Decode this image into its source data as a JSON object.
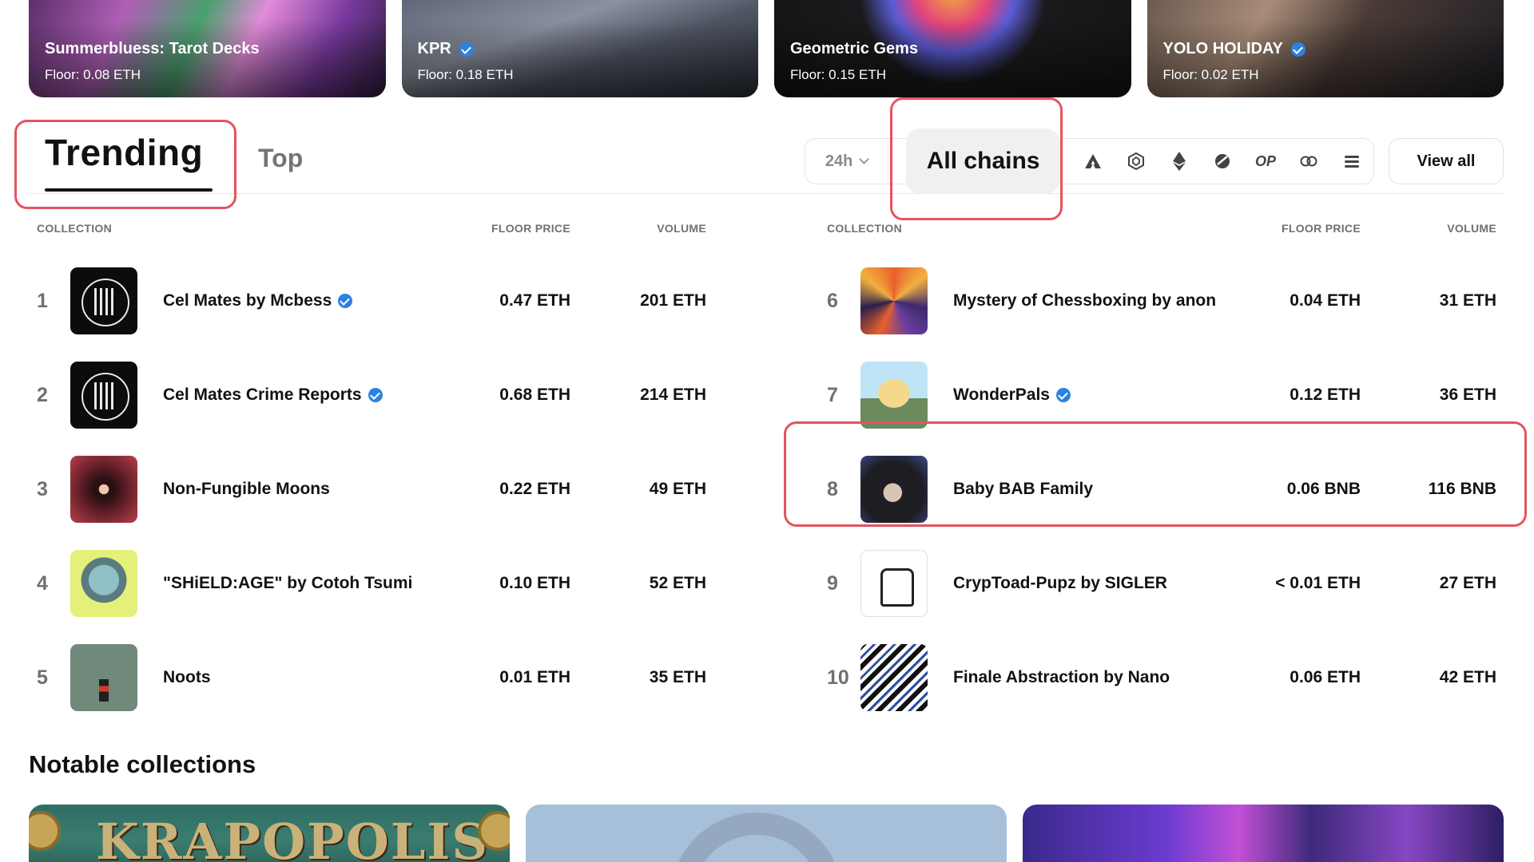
{
  "featured": [
    {
      "title": "Summerbluess: Tarot Decks",
      "floor": "Floor: 0.08 ETH",
      "verified": false
    },
    {
      "title": "KPR",
      "floor": "Floor: 0.18 ETH",
      "verified": true
    },
    {
      "title": "Geometric Gems",
      "floor": "Floor: 0.15 ETH",
      "verified": false
    },
    {
      "title": "YOLO HOLIDAY",
      "floor": "Floor: 0.02 ETH",
      "verified": true
    }
  ],
  "tabs": {
    "trending": "Trending",
    "top": "Top"
  },
  "filters": {
    "period": "24h",
    "all_chains": "All chains",
    "chain_icons": [
      "arbitrum-icon",
      "bnb-icon",
      "ethereum-icon",
      "zora-icon",
      "optimism-icon",
      "link-icon",
      "more-chains-icon"
    ],
    "op_label": "OP"
  },
  "view_all": "View all",
  "columns": {
    "collection": "COLLECTION",
    "floor": "FLOOR PRICE",
    "volume": "VOLUME"
  },
  "left_rows": [
    {
      "rank": "1",
      "name": "Cel Mates by Mcbess",
      "floor": "0.47 ETH",
      "volume": "201 ETH",
      "verified": true
    },
    {
      "rank": "2",
      "name": "Cel Mates Crime Reports",
      "floor": "0.68 ETH",
      "volume": "214 ETH",
      "verified": true
    },
    {
      "rank": "3",
      "name": "Non-Fungible Moons",
      "floor": "0.22 ETH",
      "volume": "49 ETH",
      "verified": false
    },
    {
      "rank": "4",
      "name": "\"SHiELD:AGE\" by Cotoh Tsumi",
      "floor": "0.10 ETH",
      "volume": "52 ETH",
      "verified": false
    },
    {
      "rank": "5",
      "name": "Noots",
      "floor": "0.01 ETH",
      "volume": "35 ETH",
      "verified": false
    }
  ],
  "right_rows": [
    {
      "rank": "6",
      "name": "Mystery of Chessboxing by anon",
      "floor": "0.04 ETH",
      "volume": "31 ETH",
      "verified": false
    },
    {
      "rank": "7",
      "name": "WonderPals",
      "floor": "0.12 ETH",
      "volume": "36 ETH",
      "verified": true
    },
    {
      "rank": "8",
      "name": "Baby BAB Family",
      "floor": "0.06 BNB",
      "volume": "116 BNB",
      "verified": false
    },
    {
      "rank": "9",
      "name": "CrypToad-Pupz by SIGLER",
      "floor": "< 0.01 ETH",
      "volume": "27 ETH",
      "verified": false
    },
    {
      "rank": "10",
      "name": "Finale Abstraction by Nano",
      "floor": "0.06 ETH",
      "volume": "42 ETH",
      "verified": false
    }
  ],
  "notable": {
    "title": "Notable collections",
    "cards": [
      {
        "word": "KRAPOPOLIS"
      },
      {
        "word": ""
      },
      {
        "word": ""
      }
    ]
  },
  "colors": {
    "highlight": "#e5535e",
    "verified": "#2d81e2",
    "muted": "#707070"
  }
}
